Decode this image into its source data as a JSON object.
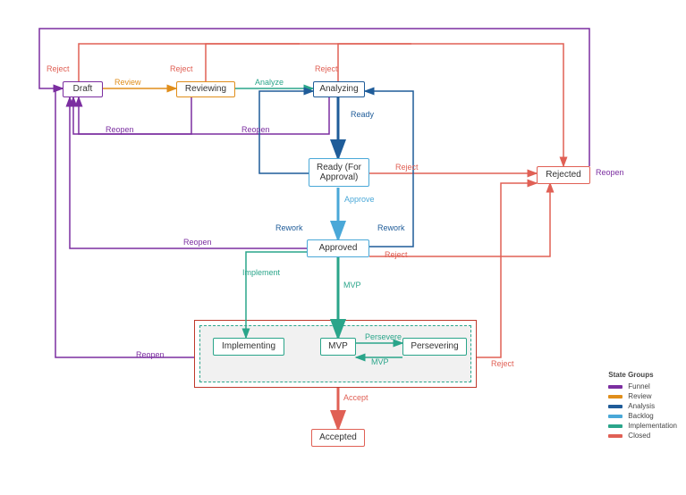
{
  "colors": {
    "funnel": "#7b2ea0",
    "review": "#e08e1b",
    "analysis": "#1f5c99",
    "backlog": "#4aa8d8",
    "implementation": "#2aa58a",
    "closed": "#e06055"
  },
  "nodes": {
    "draft": "Draft",
    "reviewing": "Reviewing",
    "analyzing": "Analyzing",
    "ready": "Ready (For Approval)",
    "approved": "Approved",
    "implementing": "Implementing",
    "mvp": "MVP",
    "persevering": "Persevering",
    "rejected": "Rejected",
    "accepted": "Accepted"
  },
  "edges": [
    {
      "from": "draft",
      "to": "reviewing",
      "label": "Review",
      "group": "review"
    },
    {
      "from": "reviewing",
      "to": "analyzing",
      "label": "Analyze",
      "group": "implementation"
    },
    {
      "from": "draft",
      "to": "rejected",
      "label": "Reject",
      "group": "closed"
    },
    {
      "from": "reviewing",
      "to": "rejected",
      "label": "Reject",
      "group": "closed"
    },
    {
      "from": "analyzing",
      "to": "rejected",
      "label": "Reject",
      "group": "closed"
    },
    {
      "from": "reviewing",
      "to": "draft",
      "label": "Reopen",
      "group": "funnel"
    },
    {
      "from": "analyzing",
      "to": "draft",
      "label": "Reopen",
      "group": "funnel"
    },
    {
      "from": "analyzing",
      "to": "ready",
      "label": "Ready",
      "group": "analysis"
    },
    {
      "from": "ready",
      "to": "approved",
      "label": "Approve",
      "group": "backlog"
    },
    {
      "from": "ready",
      "to": "rejected",
      "label": "Reject",
      "group": "closed"
    },
    {
      "from": "approved",
      "to": "rejected",
      "label": "Reject",
      "group": "closed"
    },
    {
      "from": "ready",
      "to": "analyzing",
      "label": "Rework",
      "group": "analysis"
    },
    {
      "from": "approved",
      "to": "analyzing",
      "label": "Rework",
      "group": "analysis"
    },
    {
      "from": "approved",
      "to": "draft",
      "label": "Reopen",
      "group": "funnel"
    },
    {
      "from": "approved",
      "to": "implementing",
      "label": "Implement",
      "group": "implementation"
    },
    {
      "from": "approved",
      "to": "mvp",
      "label": "MVP",
      "group": "implementation"
    },
    {
      "from": "mvp",
      "to": "persevering",
      "label": "Persevere",
      "group": "implementation"
    },
    {
      "from": "persevering",
      "to": "mvp",
      "label": "MVP",
      "group": "implementation"
    },
    {
      "from": "mvp",
      "to": "accepted",
      "label": "Accept",
      "group": "closed"
    },
    {
      "from": "implementation_group",
      "to": "rejected",
      "label": "Reject",
      "group": "closed"
    },
    {
      "from": "implementation_group",
      "to": "draft",
      "label": "Reopen",
      "group": "funnel"
    },
    {
      "from": "rejected",
      "to": "draft",
      "label": "Reopen",
      "group": "funnel"
    }
  ],
  "legend": {
    "title": "State Groups",
    "items": [
      {
        "label": "Funnel",
        "style": "background:#7b2ea0"
      },
      {
        "label": "Review",
        "style": "background:#e08e1b"
      },
      {
        "label": "Analysis",
        "style": "background:#1f5c99"
      },
      {
        "label": "Backlog",
        "style": "background:#4aa8d8"
      },
      {
        "label": "Implementation",
        "style": "background:#2aa58a"
      },
      {
        "label": "Closed",
        "style": "background:#e06055"
      }
    ]
  }
}
